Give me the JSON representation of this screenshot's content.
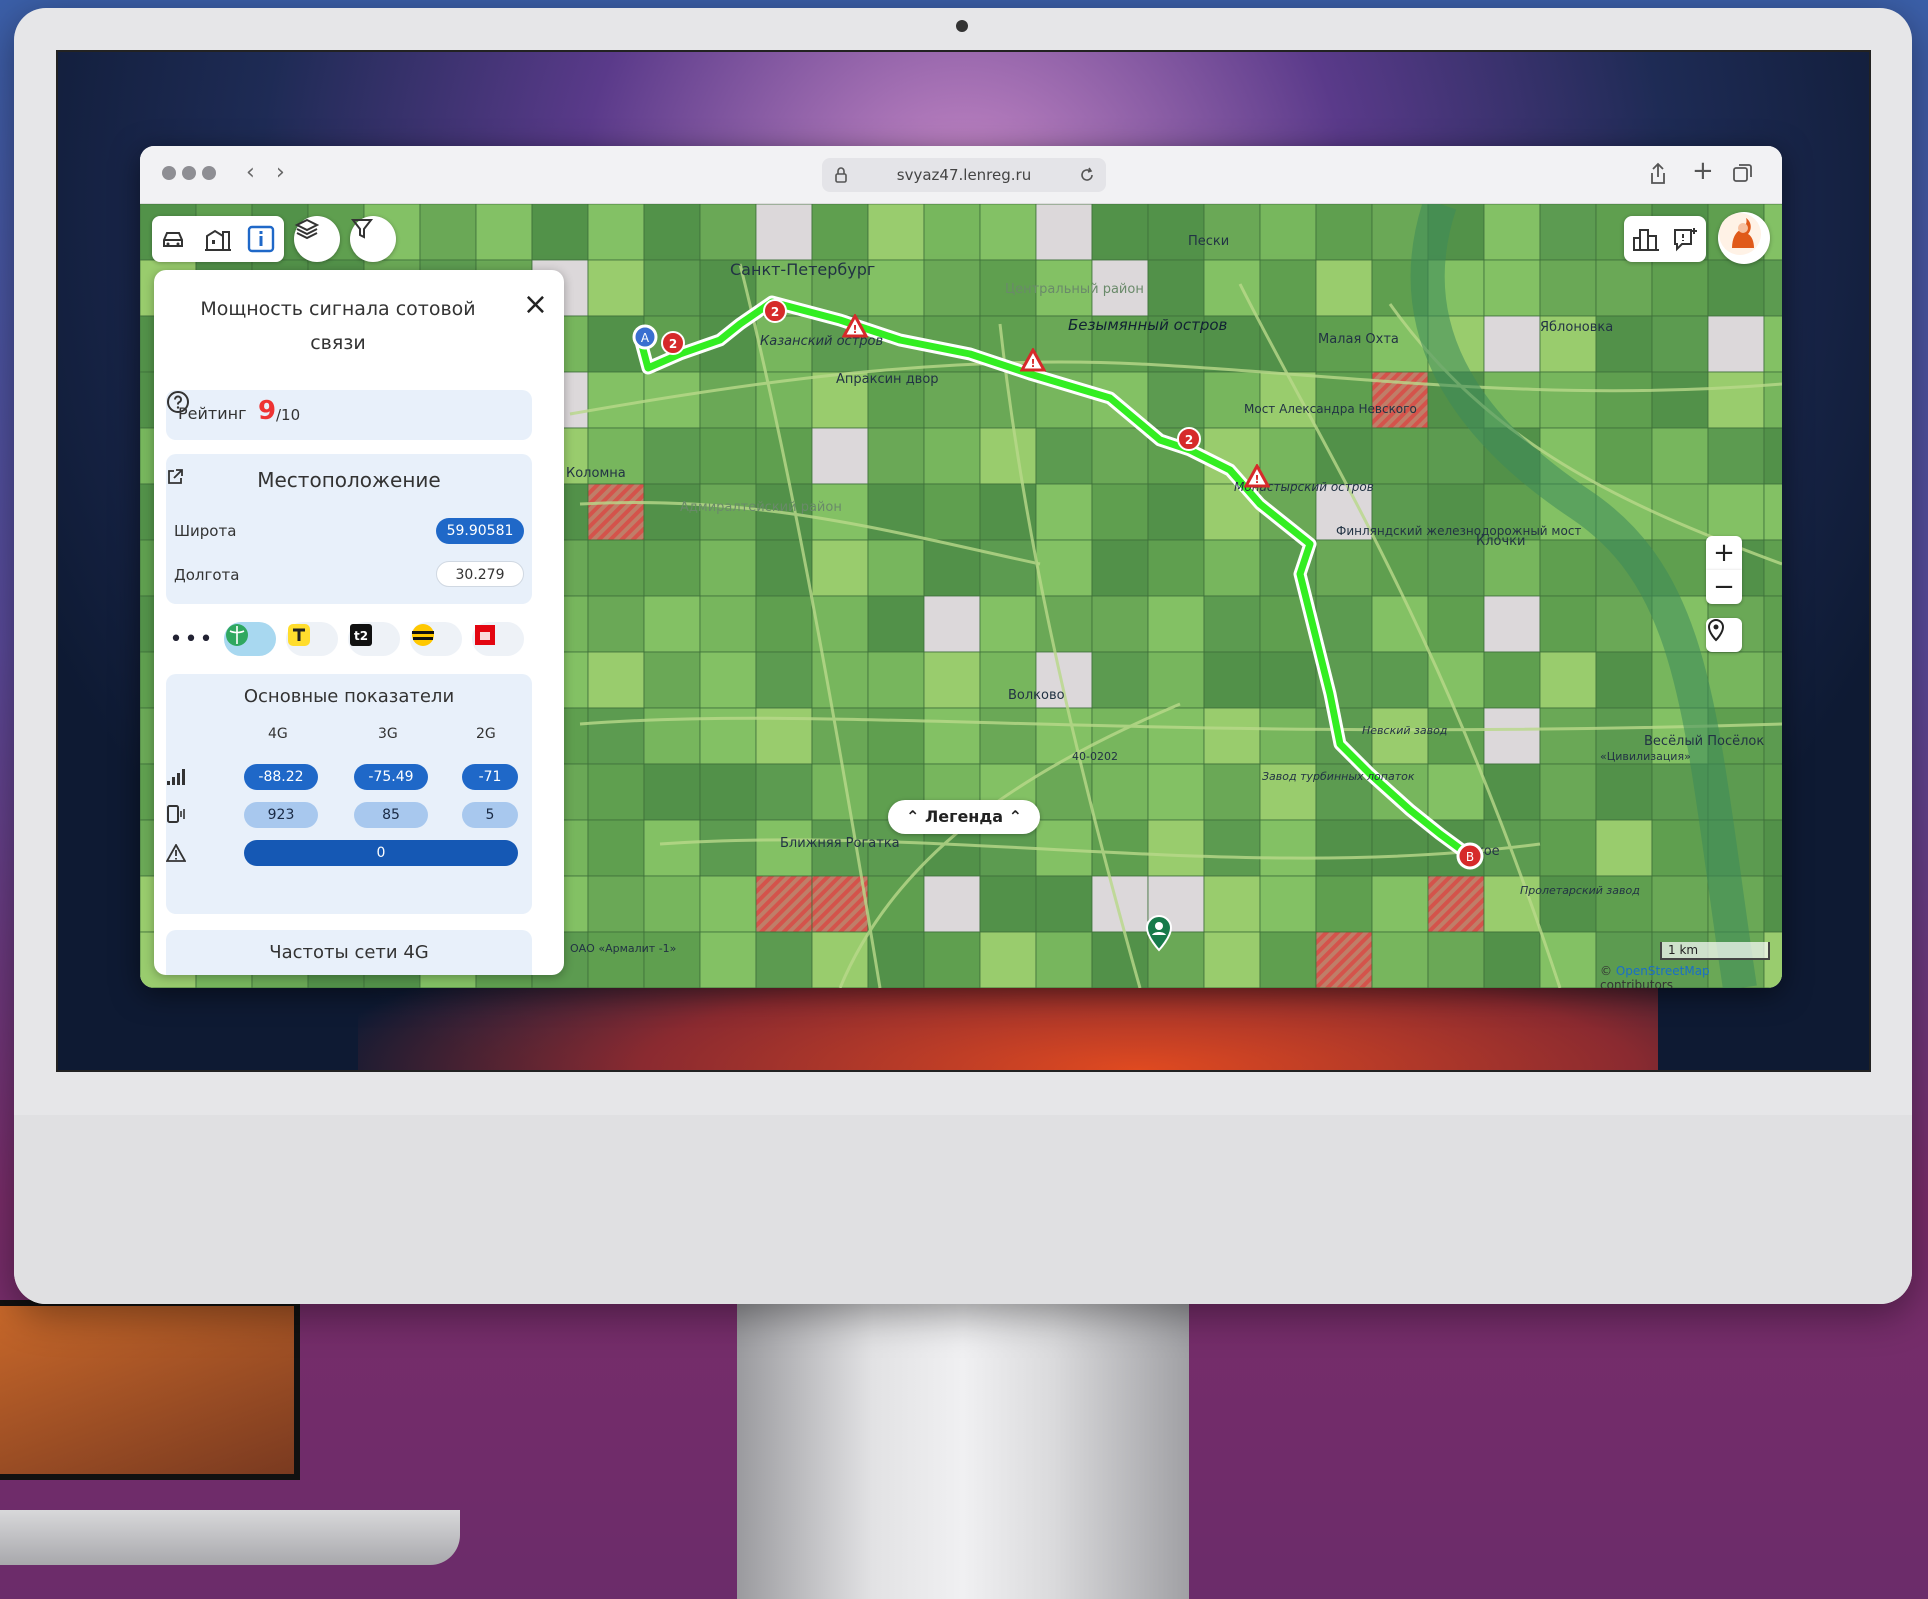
{
  "browser": {
    "url": "svyaz47.lenreg.ru"
  },
  "panel": {
    "title": "Мощность сигнала сотовой связи",
    "rating": {
      "label": "Рейтинг",
      "value": "9",
      "max": "/10"
    },
    "location": {
      "title": "Местоположение",
      "lat_label": "Широта",
      "lat_value": "59.90581",
      "lon_label": "Долгота",
      "lon_value": "30.279"
    },
    "metrics": {
      "title": "Основные показатели",
      "gen_4g": "4G",
      "gen_3g": "3G",
      "gen_2g": "2G",
      "signal": [
        "-88.22",
        "-75.49",
        "-71"
      ],
      "devices": [
        "923",
        "85",
        "5"
      ],
      "warnings": "0"
    },
    "freq": {
      "title": "Частоты сети 4G"
    }
  },
  "map": {
    "legend_label": "Легенда",
    "scale_label": "1 km",
    "attribution_prefix": "© ",
    "attribution_link": "OpenStreetMap",
    "attribution_suffix": " contributors",
    "route_start_marker": "A",
    "route_end_marker": "B",
    "cluster_count": "2",
    "labels": {
      "spb": "Санкт-Петербург",
      "center": "Центральный район",
      "bezymyanny": "Безымянный остров",
      "peski": "Пески",
      "malaya_okhta": "Малая Охта",
      "yablonovka": "Яблоновка",
      "kolomna": "Коломна",
      "kazansky": "Казанский остров",
      "apraksin": "Апраксин двор",
      "most_nevskogo": "Мост Александра Невского",
      "monastyrsky": "Монастырский остров",
      "finlyandsky": "Финляндский железнодорожный мост",
      "klochki": "Клочки",
      "volkovo": "Волково",
      "blizhnyaya": "Ближняя Рогатка",
      "vesely": "Весёлый Посёлок",
      "admiralteysky": "Адмиралтейский район",
      "road_40": "40-0202",
      "nevsky_zavod": "Невский завод",
      "turbinny": "Завод турбинных лопаток",
      "armalit": "ОАО «Армалит -1»",
      "proletarsky": "Пролетарский завод",
      "tsivilizatsiya": "«Цивилизация»",
      "kosoe": "хое"
    }
  },
  "colors": {
    "route": "#33ee22",
    "accent": "#1f68c8",
    "rating": "#e33333",
    "marker_red": "#d62a2a"
  }
}
